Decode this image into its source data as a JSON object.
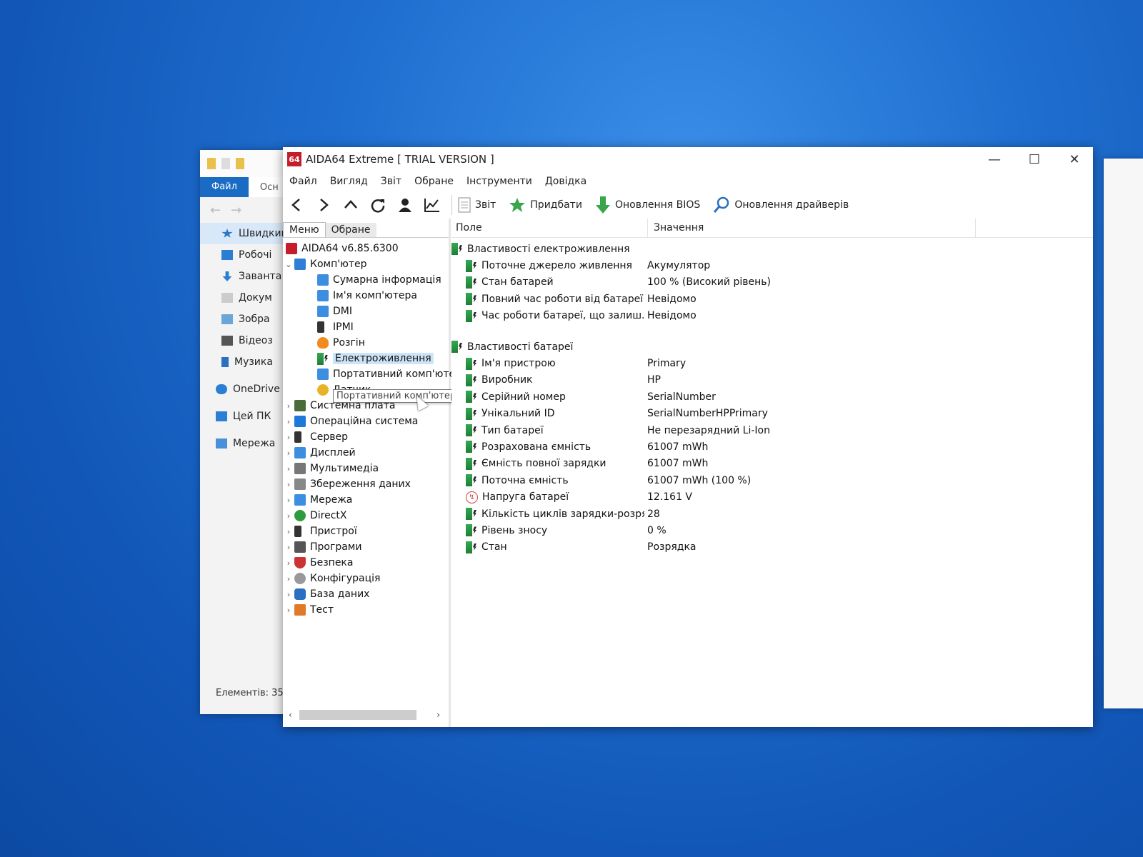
{
  "explorer": {
    "file_tab": "Файл",
    "ribbon_tab": "Осн",
    "nav": [
      "Швидкий",
      "Робочі",
      "Заванта",
      "Докум",
      "Зобра",
      "Відеоз",
      "Музика",
      "OneDrive",
      "Цей ПК",
      "Мережа"
    ],
    "status": "Елементів: 35"
  },
  "window": {
    "title": "AIDA64 Extreme  [ TRIAL VERSION ]",
    "logo": "64",
    "minimize": "—",
    "maximize": "☐",
    "close": "✕"
  },
  "menu": [
    "Файл",
    "Вигляд",
    "Звіт",
    "Обране",
    "Інструменти",
    "Довідка"
  ],
  "toolbar": {
    "report": "Звіт",
    "buy": "Придбати",
    "bios_update": "Оновлення BIOS",
    "driver_update": "Оновлення драйверів"
  },
  "left_tabs": {
    "menu": "Меню",
    "favorites": "Обране"
  },
  "tree": {
    "root": "AIDA64 v6.85.6300",
    "computer": "Комп'ютер",
    "computer_children": [
      "Сумарна інформація",
      "Ім'я комп'ютера",
      "DMI",
      "IPMI",
      "Розгін",
      "Електроживлення",
      "Портативний комп'ютер",
      "Датчик"
    ],
    "categories": [
      "Системна плата",
      "Операційна система",
      "Сервер",
      "Дисплей",
      "Мультимедіа",
      "Збереження даних",
      "Мережа",
      "DirectX",
      "Пристрої",
      "Програми",
      "Безпека",
      "Конфігурація",
      "База даних",
      "Тест"
    ]
  },
  "tooltip": "Портативний комп'ютер",
  "columns": {
    "field": "Поле",
    "value": "Значення"
  },
  "power_section": {
    "title": "Властивості електроживлення",
    "rows": [
      {
        "field": "Поточне джерело живлення",
        "value": "Акумулятор"
      },
      {
        "field": "Стан батарей",
        "value": "100 % (Високий рівень)"
      },
      {
        "field": "Повний час роботи від батареї",
        "value": "Невідомо"
      },
      {
        "field": "Час роботи батареї, що залиш...",
        "value": "Невідомо"
      }
    ]
  },
  "battery_section": {
    "title": "Властивості батареї",
    "rows": [
      {
        "field": "Ім'я пристрою",
        "value": "Primary"
      },
      {
        "field": "Виробник",
        "value": "HP"
      },
      {
        "field": "Серійний номер",
        "value": "SerialNumber"
      },
      {
        "field": "Унікальний ID",
        "value": "SerialNumberHPPrimary"
      },
      {
        "field": "Тип батареї",
        "value": "Не перезарядний Li-Ion"
      },
      {
        "field": "Розрахована ємність",
        "value": "61007 mWh"
      },
      {
        "field": "Ємність повної зарядки",
        "value": "61007 mWh"
      },
      {
        "field": "Поточна ємність",
        "value": "61007 mWh  (100 %)"
      },
      {
        "field": "Напруга батареї",
        "value": "12.161 V"
      },
      {
        "field": "Кількість циклів зарядки-розря...",
        "value": "28"
      },
      {
        "field": "Рівень зносу",
        "value": "0 %"
      },
      {
        "field": "Стан",
        "value": "Розрядка"
      }
    ]
  }
}
